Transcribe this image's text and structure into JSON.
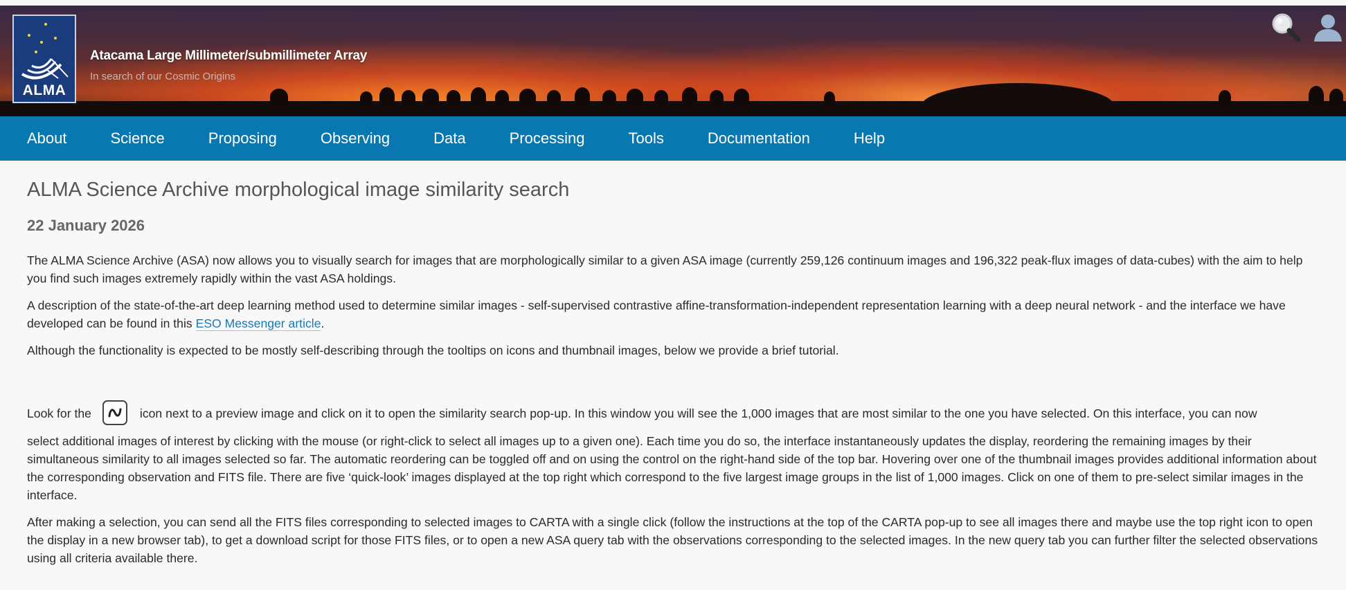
{
  "header": {
    "logo_text": "ALMA",
    "site_title": "Atacama Large Millimeter/submillimeter Array",
    "site_subtitle": "In search of our Cosmic Origins",
    "search_icon": "search-icon",
    "user_icon": "user-icon"
  },
  "nav": {
    "items": [
      {
        "label": "About"
      },
      {
        "label": "Science"
      },
      {
        "label": "Proposing"
      },
      {
        "label": "Observing"
      },
      {
        "label": "Data"
      },
      {
        "label": "Processing"
      },
      {
        "label": "Tools"
      },
      {
        "label": "Documentation"
      },
      {
        "label": "Help"
      }
    ]
  },
  "article": {
    "title": "ALMA Science Archive morphological image similarity search",
    "date": "22 January 2026",
    "p1": "The ALMA Science Archive (ASA) now allows you to visually search for images that are morphologically similar to a given ASA image (currently 259,126 continuum images and 196,322 peak-flux images of data-cubes) with the aim to help you find such images extremely rapidly within the vast ASA holdings.",
    "p2_before": "A description of the state-of-the-art deep learning method used to determine similar images - self-supervised contrastive affine-transformation-independent representation learning with a deep neural network - and the interface we have developed can be found in this ",
    "p2_link": "ESO Messenger article",
    "p2_after": ".",
    "p3": "Although the functionality is expected to be mostly self-describing through the tooltips on icons and thumbnail images, below we provide a brief tutorial.",
    "p4_before": "Look for the",
    "p4_icon": "similarity-icon",
    "p4_after_line1": "icon next to a preview image and click on it to open the similarity search pop-up. In this window you will see the 1,000 images that are most similar to the one you have selected. On this interface, you can now",
    "p4_rest": "select additional images of interest by clicking with the mouse (or right-click to select all images up to a given one). Each time you do so, the interface instantaneously updates the display, reordering the remaining images by their simultaneous similarity to all images selected so far. The automatic reordering can be toggled off and on using the control on the right-hand side of the top bar. Hovering over one of the thumbnail images provides additional information about the corresponding observation and FITS file. There are five ‘quick-look’ images displayed at the top right which correspond to the five largest image groups in the list of 1,000 images. Click on one of them to pre-select similar images in the interface.",
    "p5": "After making a selection, you can send all the FITS files corresponding to selected images to CARTA with a single click (follow the instructions at the top of the CARTA pop-up to see all images there and maybe use the top right icon to open the display in a new browser tab), to get a download script for those FITS files, or to open a new ASA query tab with the observations corresponding to the selected images. In the new query tab you can further filter the selected observations using all criteria available there."
  },
  "colors": {
    "nav_bg": "#0a78b0",
    "link": "#1a78b5",
    "page_bg": "#f8f8f8"
  }
}
